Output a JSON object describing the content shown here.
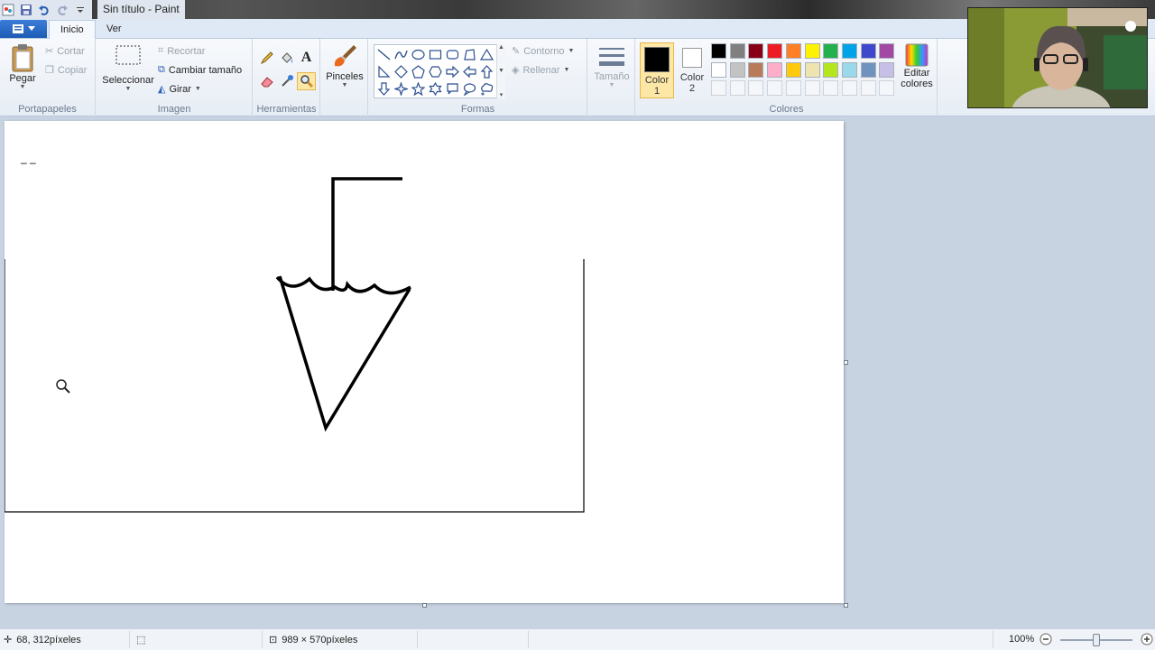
{
  "window": {
    "title": "Sin título - Paint"
  },
  "tabs": {
    "file_label": "",
    "home": "Inicio",
    "view": "Ver"
  },
  "clipboard": {
    "paste": "Pegar",
    "cut": "Cortar",
    "copy": "Copiar",
    "group": "Portapapeles"
  },
  "image": {
    "select": "Seleccionar",
    "crop": "Recortar",
    "resize": "Cambiar tamaño",
    "rotate": "Girar",
    "group": "Imagen"
  },
  "tools": {
    "group": "Herramientas",
    "brushes": "Pinceles",
    "active_tool": "magnifier"
  },
  "shapes": {
    "group": "Formas",
    "outline": "Contorno",
    "fill": "Rellenar"
  },
  "size": {
    "label": "Tamaño"
  },
  "colors": {
    "group": "Colores",
    "color1_label": "Color 1",
    "color2_label": "Color 2",
    "edit": "Editar colores",
    "color1": "#000000",
    "color2": "#ffffff",
    "palette_row1": [
      "#000000",
      "#7f7f7f",
      "#880015",
      "#ed1c24",
      "#ff7f27",
      "#fff200",
      "#22b14c",
      "#00a2e8",
      "#3f48cc",
      "#a349a4"
    ],
    "palette_row2": [
      "#ffffff",
      "#c3c3c3",
      "#b97a57",
      "#ffaec9",
      "#ffc90e",
      "#efe4b0",
      "#b5e61d",
      "#99d9ea",
      "#7092be",
      "#c8bfe7"
    ]
  },
  "status": {
    "cursor_position": "68, 312píxeles",
    "canvas_size": "989 × 570píxeles",
    "zoom": "100%"
  },
  "canvas_marks": {
    "dashes": "–  –"
  }
}
